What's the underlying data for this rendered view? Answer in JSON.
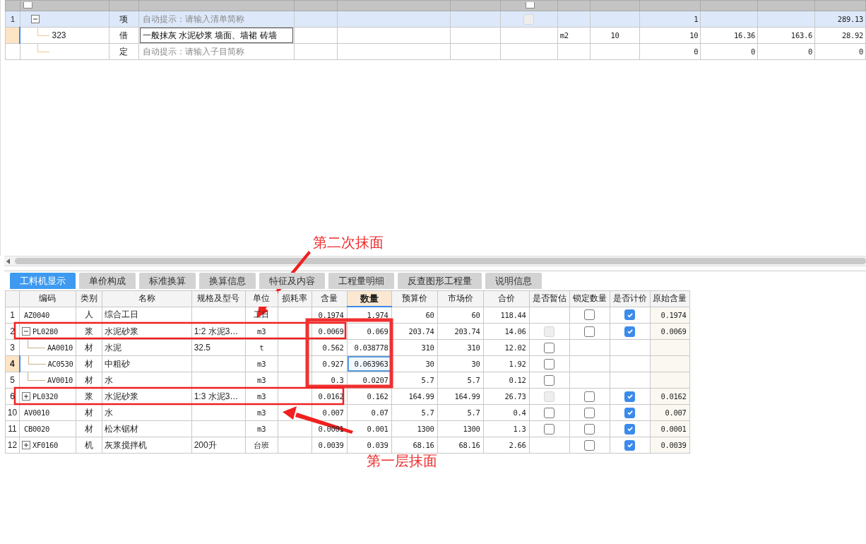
{
  "top_grid": {
    "header_checkboxes": [
      {
        "checked": false
      },
      {
        "checked": false
      }
    ],
    "rows": [
      {
        "kind": "list",
        "number": "1",
        "selected": false,
        "editing": false,
        "expanded": true,
        "type": "项",
        "placeholder": "自动提示：请输入清单简称",
        "checkbox": {
          "checked": false,
          "disabled": true
        },
        "cells": {
          "column_11": "1",
          "column_14": "289.13"
        },
        "children": [
          {
            "kind": "item",
            "selected": true,
            "editing": true,
            "code": "323",
            "type": "借",
            "name": "一般抹灰  水泥砂浆  墙面、墙裙  砖墙",
            "cells": {
              "column_9": "m2",
              "column_10": "10",
              "column_11": "10",
              "column_12": "16.36",
              "column_13": "163.6",
              "column_14": "28.92"
            }
          },
          {
            "kind": "item",
            "selected": false,
            "editing": false,
            "type": "定",
            "placeholder": "自动提示：请输入子目简称",
            "cells": {
              "column_11": "0",
              "column_12": "0",
              "column_13": "0",
              "column_14": "0"
            }
          }
        ]
      }
    ]
  },
  "tabs": [
    {
      "label": "工料机显示",
      "selected": true
    },
    {
      "label": "单价构成",
      "selected": false
    },
    {
      "label": "标准换算",
      "selected": false
    },
    {
      "label": "换算信息",
      "selected": false
    },
    {
      "label": "特征及内容",
      "selected": false
    },
    {
      "label": "工程量明细",
      "selected": false
    },
    {
      "label": "反查图形工程量",
      "selected": false
    },
    {
      "label": "说明信息",
      "selected": false
    }
  ],
  "resource_grid": {
    "columns": [
      {
        "label": "编码",
        "selected": false
      },
      {
        "label": "类别",
        "selected": false
      },
      {
        "label": "名称",
        "selected": false
      },
      {
        "label": "规格及型号",
        "selected": false
      },
      {
        "label": "单位",
        "selected": false
      },
      {
        "label": "损耗率",
        "selected": false
      },
      {
        "label": "含量",
        "selected": false
      },
      {
        "label": "数量",
        "selected": true
      },
      {
        "label": "预算价",
        "selected": false
      },
      {
        "label": "市场价",
        "selected": false
      },
      {
        "label": "合价",
        "selected": false
      },
      {
        "label": "是否暂估",
        "selected": false
      },
      {
        "label": "锁定数量",
        "selected": false
      },
      {
        "label": "是否计价",
        "selected": false
      },
      {
        "label": "原始含量",
        "selected": false
      }
    ],
    "rows": [
      {
        "number": "1",
        "selected": false,
        "quantity_focused": false,
        "code": "AZ0040",
        "category": "人",
        "name": "综合工日",
        "unit": "工日",
        "content": "0.1974",
        "quantity": "1.974",
        "budget_price": "60",
        "market_price": "60",
        "total": "118.44",
        "lock": {
          "checked": false
        },
        "priced": {
          "checked": true
        },
        "original": "0.1974"
      },
      {
        "number": "2",
        "selected": false,
        "quantity_focused": false,
        "expanded": true,
        "code": "PL0280",
        "category": "浆",
        "name": "水泥砂浆",
        "spec": "1:2 水泥3…",
        "unit": "m3",
        "content": "0.0069",
        "quantity": "0.069",
        "budget_price": "203.74",
        "market_price": "203.74",
        "total": "14.06",
        "estimate": {
          "checked": false,
          "disabled": true
        },
        "lock": {
          "checked": false
        },
        "priced": {
          "checked": true
        },
        "original": "0.0069",
        "children": [
          {
            "number": "3",
            "selected": false,
            "quantity_focused": false,
            "code": "AA0010",
            "category": "材",
            "name": "水泥",
            "spec": "32.5",
            "unit": "t",
            "content": "0.562",
            "quantity": "0.038778",
            "budget_price": "310",
            "market_price": "310",
            "total": "12.02",
            "estimate": {
              "checked": false,
              "disabled": false
            }
          },
          {
            "number": "4",
            "selected": true,
            "quantity_focused": true,
            "code": "AC0530",
            "category": "材",
            "name": "中粗砂",
            "unit": "m3",
            "content": "0.927",
            "quantity": "0.063963",
            "budget_price": "30",
            "market_price": "30",
            "total": "1.92",
            "estimate": {
              "checked": false,
              "disabled": false
            }
          },
          {
            "number": "5",
            "selected": false,
            "quantity_focused": false,
            "code": "AV0010",
            "category": "材",
            "name": "水",
            "unit": "m3",
            "content": "0.3",
            "quantity": "0.0207",
            "budget_price": "5.7",
            "market_price": "5.7",
            "total": "0.12",
            "estimate": {
              "checked": false,
              "disabled": false
            }
          }
        ]
      },
      {
        "number": "6",
        "selected": false,
        "quantity_focused": false,
        "expanded": false,
        "code": "PL0320",
        "category": "浆",
        "name": "水泥砂浆",
        "spec": "1:3 水泥3…",
        "unit": "m3",
        "content": "0.0162",
        "quantity": "0.162",
        "budget_price": "164.99",
        "market_price": "164.99",
        "total": "26.73",
        "estimate": {
          "checked": false,
          "disabled": true
        },
        "lock": {
          "checked": false
        },
        "priced": {
          "checked": true
        },
        "original": "0.0162"
      },
      {
        "number": "10",
        "selected": false,
        "quantity_focused": false,
        "code": "AV0010",
        "category": "材",
        "name": "水",
        "unit": "m3",
        "content": "0.007",
        "quantity": "0.07",
        "budget_price": "5.7",
        "market_price": "5.7",
        "total": "0.4",
        "estimate": {
          "checked": false,
          "disabled": false
        },
        "lock": {
          "checked": false
        },
        "priced": {
          "checked": true
        },
        "original": "0.007"
      },
      {
        "number": "11",
        "selected": false,
        "quantity_focused": false,
        "code": "CB0020",
        "category": "材",
        "name": "松木锯材",
        "unit": "m3",
        "content": "0.0001",
        "quantity": "0.001",
        "budget_price": "1300",
        "market_price": "1300",
        "total": "1.3",
        "estimate": {
          "checked": false,
          "disabled": false
        },
        "lock": {
          "checked": false
        },
        "priced": {
          "checked": true
        },
        "original": "0.0001"
      },
      {
        "number": "12",
        "selected": false,
        "quantity_focused": false,
        "expanded": false,
        "code": "XF0160",
        "category": "机",
        "name": "灰浆搅拌机",
        "spec": "200升",
        "unit": "台班",
        "content": "0.0039",
        "quantity": "0.039",
        "budget_price": "68.16",
        "market_price": "68.16",
        "total": "2.66",
        "lock": {
          "checked": false
        },
        "priced": {
          "checked": true
        },
        "original": "0.0039"
      }
    ]
  },
  "annotations": [
    "第二次抹面",
    "第一层抹面"
  ]
}
